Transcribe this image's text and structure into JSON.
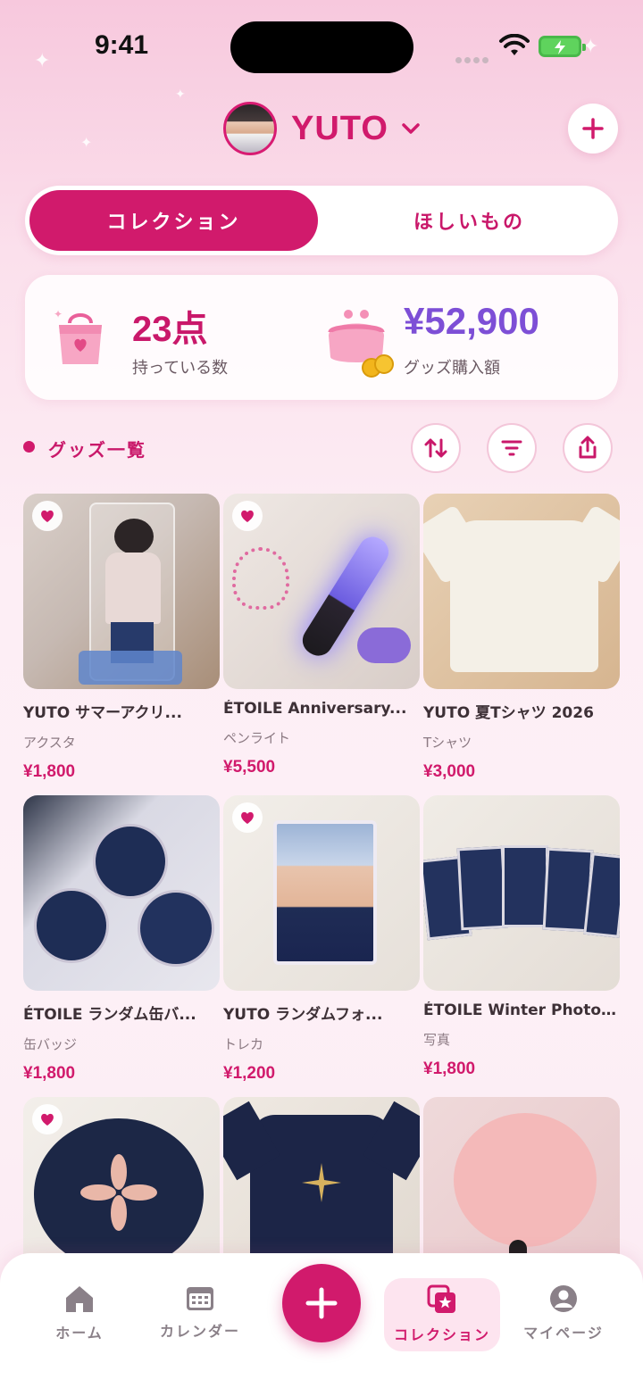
{
  "status_bar": {
    "time": "9:41"
  },
  "header": {
    "profile_name": "YUTO"
  },
  "tabs": [
    {
      "label": "コレクション",
      "active": true
    },
    {
      "label": "ほしいもの",
      "active": false
    }
  ],
  "summary": {
    "count_value": "23点",
    "count_label": "持っている数",
    "amount_value": "¥52,900",
    "amount_label": "グッズ購入額"
  },
  "section": {
    "title": "グッズ一覧"
  },
  "items": [
    {
      "title": "YUTO サマーアクリ...",
      "category": "アクスタ",
      "price": "¥1,800",
      "favorite": true
    },
    {
      "title": "ÉTOILE Anniversary...",
      "category": "ペンライト",
      "price": "¥5,500",
      "favorite": true
    },
    {
      "title": "YUTO 夏Tシャツ 2026",
      "category": "Tシャツ",
      "price": "¥3,000",
      "favorite": false
    },
    {
      "title": "ÉTOILE ランダム缶バ...",
      "category": "缶バッジ",
      "price": "¥1,800",
      "favorite": false
    },
    {
      "title": "YUTO ランダムフォ...",
      "category": "トレカ",
      "price": "¥1,200",
      "favorite": true
    },
    {
      "title": "ÉTOILE Winter Photo...",
      "category": "写真",
      "price": "¥1,800",
      "favorite": false
    },
    {
      "title": "",
      "category": "",
      "price": "",
      "favorite": true
    },
    {
      "title": "",
      "category": "",
      "price": "",
      "favorite": false
    },
    {
      "title": "",
      "category": "",
      "price": "",
      "favorite": false
    }
  ],
  "bottom_nav": [
    {
      "label": "ホーム",
      "icon": "home-icon",
      "active": false
    },
    {
      "label": "カレンダー",
      "icon": "calendar-icon",
      "active": false
    },
    {
      "label": "コレクション",
      "icon": "collection-icon",
      "active": true
    },
    {
      "label": "マイページ",
      "icon": "profile-icon",
      "active": false
    }
  ],
  "colors": {
    "accent": "#d11a6c",
    "amount": "#7d4fd6",
    "count": "#c9186a"
  }
}
